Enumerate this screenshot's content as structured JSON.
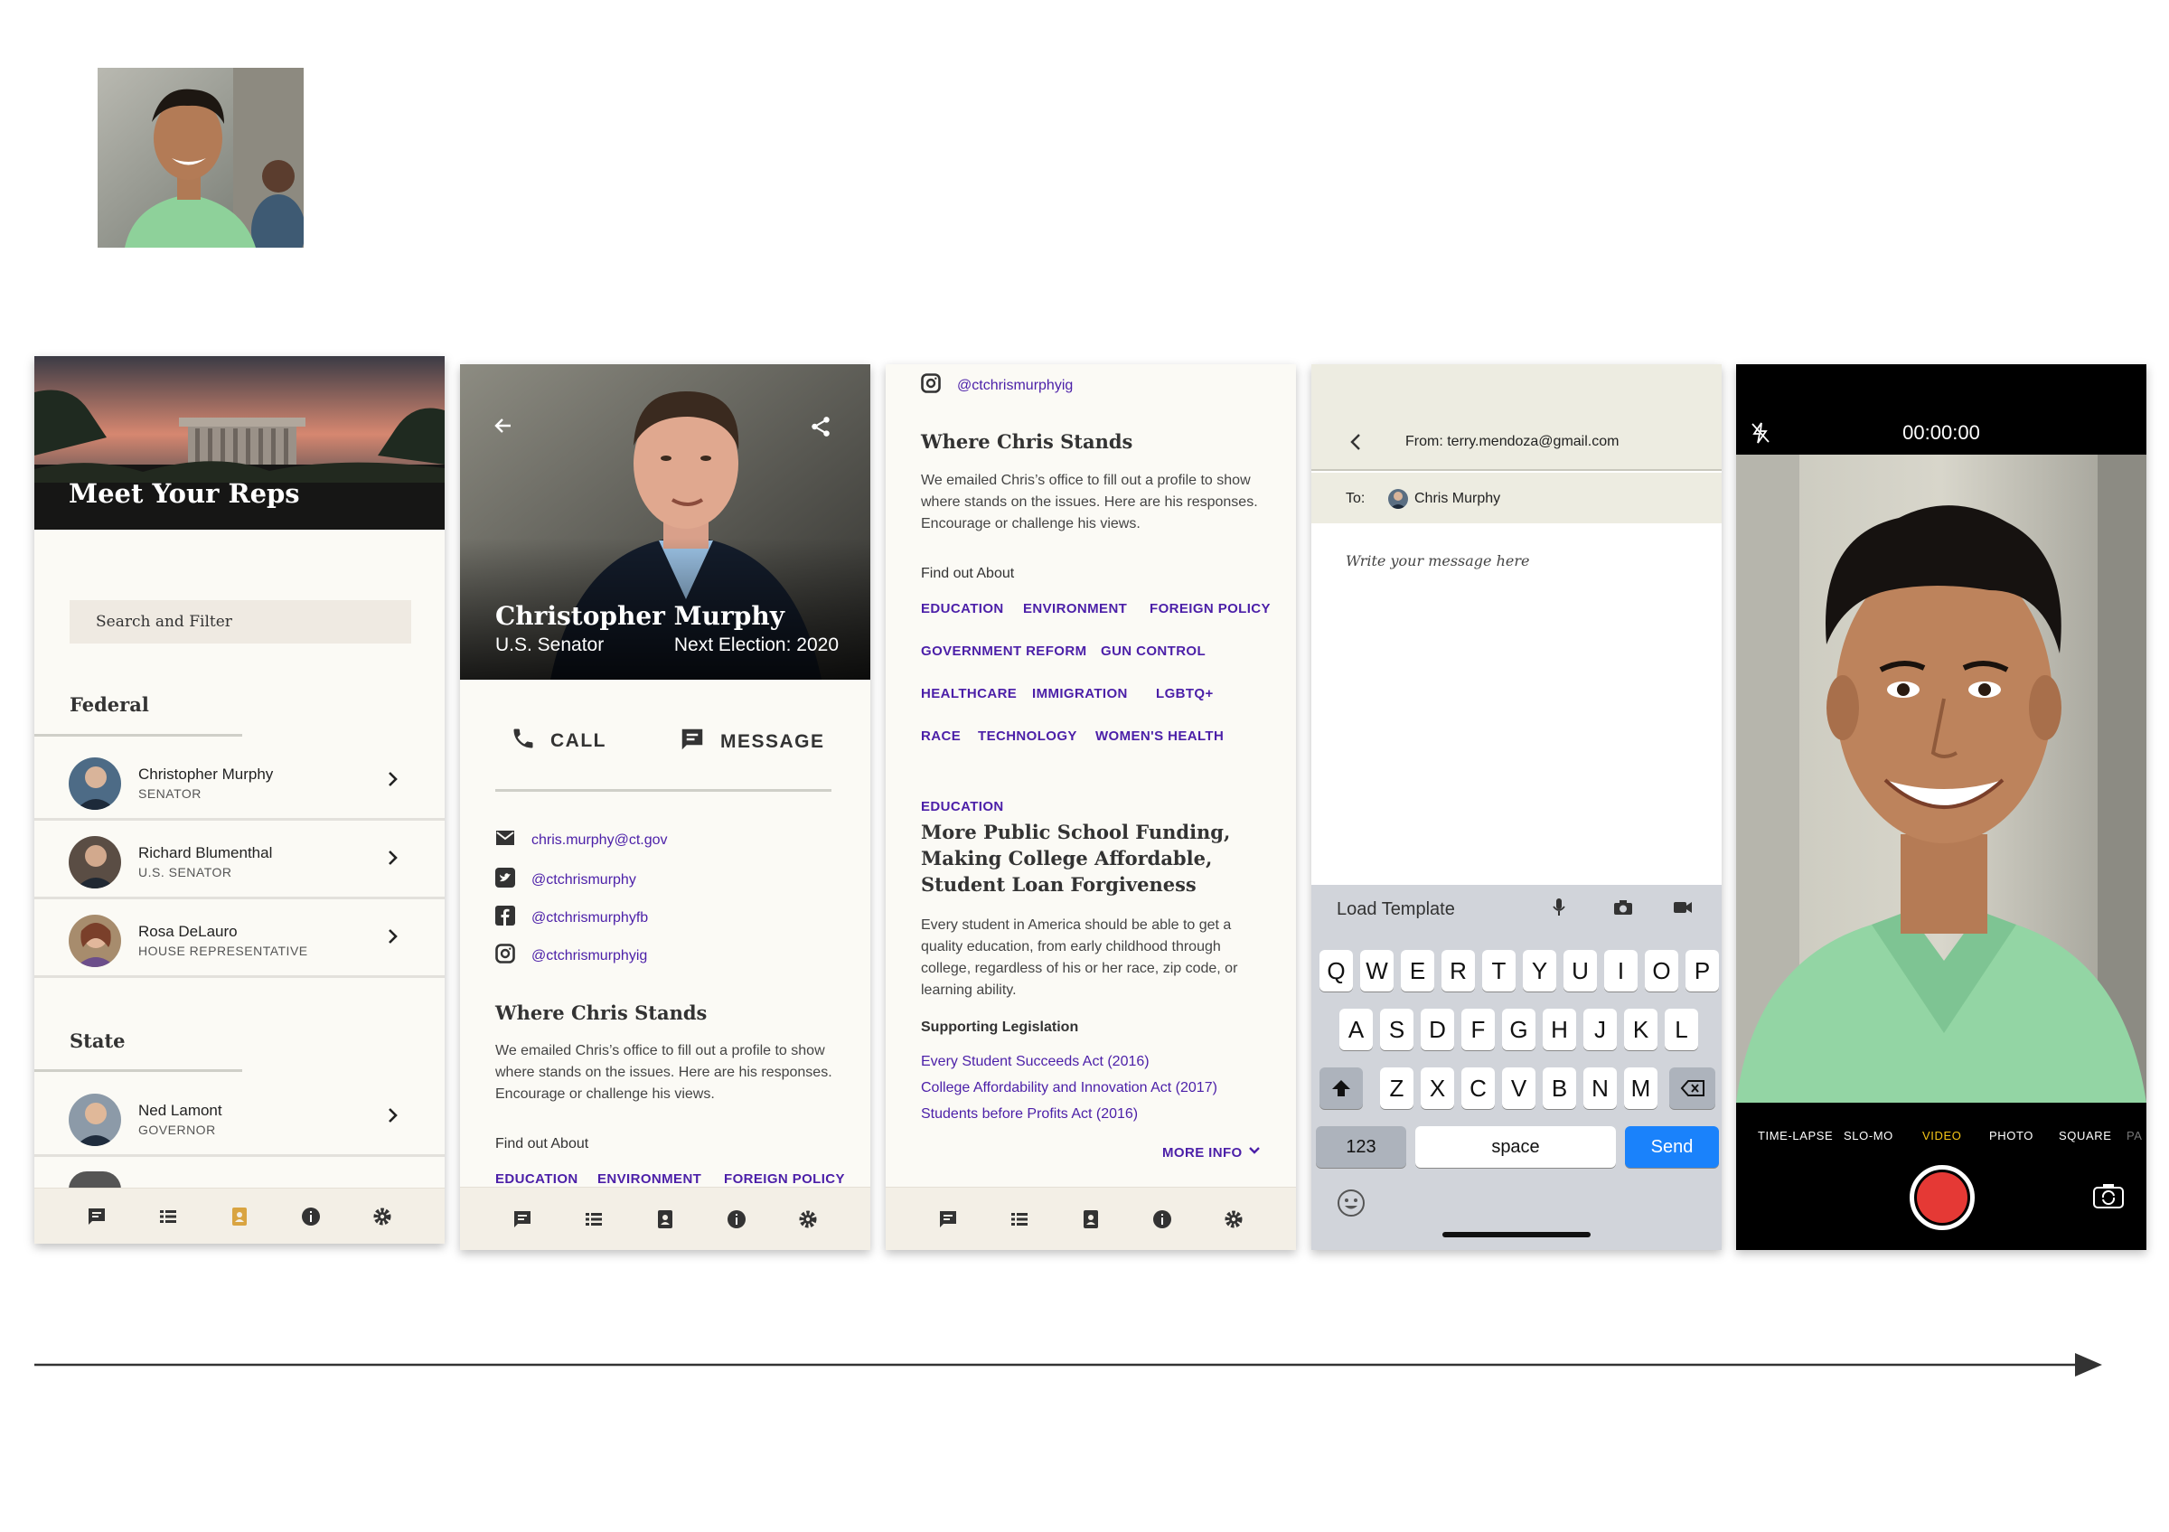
{
  "screen1": {
    "title": "Meet Your Reps",
    "search_label": "Search and Filter",
    "section_federal": "Federal",
    "section_state": "State",
    "federal_reps": [
      {
        "name": "Christopher Murphy",
        "role": "SENATOR"
      },
      {
        "name": "Richard Blumenthal",
        "role": "U.S. SENATOR"
      },
      {
        "name": "Rosa DeLauro",
        "role": "HOUSE REPRESENTATIVE"
      }
    ],
    "state_reps": [
      {
        "name": "Ned Lamont",
        "role": "GOVERNOR"
      }
    ],
    "accent": "#d9a441"
  },
  "screen2": {
    "name": "Christopher Murphy",
    "title": "U.S. Senator",
    "election": "Next Election: 2020",
    "call_label": "CALL",
    "message_label": "MESSAGE",
    "contacts": {
      "email": "chris.murphy@ct.gov",
      "twitter": "@ctchrismurphy",
      "facebook": "@ctchrismurphyfb",
      "instagram": "@ctchrismurphyig"
    },
    "stands_heading": "Where Chris Stands",
    "stands_body": "We emailed Chris’s office to fill out a profile to show where stands on the issues. Here are his responses. Encourage or challenge his views.",
    "find_out": "Find out About",
    "tags": [
      "EDUCATION",
      "ENVIRONMENT",
      "FOREIGN POLICY"
    ]
  },
  "screen3": {
    "instagram": "@ctchrismurphyig",
    "stands_heading": "Where Chris Stands",
    "stands_body": "We emailed Chris’s office to fill out a profile to show where stands on the issues. Here are his responses. Encourage or challenge his views.",
    "find_out": "Find out About",
    "tags": [
      "EDUCATION",
      "ENVIRONMENT",
      "FOREIGN POLICY",
      "GOVERNMENT REFORM",
      "GUN CONTROL",
      "HEALTHCARE",
      "IMMIGRATION",
      "LGBTQ+",
      "RACE",
      "TECHNOLOGY",
      "WOMEN'S HEALTH"
    ],
    "issue_label": "EDUCATION",
    "issue_heading": "More Public School Funding, Making College Affordable, Student Loan Forgiveness",
    "issue_body": "Every student in America should be able to get a quality education, from early childhood through college, regardless of his or her race, zip code, or learning ability.",
    "supporting": "Supporting Legislation",
    "legislation": [
      "Every Student Succeeds Act (2016)",
      "College Affordability and Innovation Act (2017)",
      "Students before Profits Act (2016)"
    ],
    "more_info": "MORE INFO"
  },
  "screen4": {
    "from": "From: terry.mendoza@gmail.com",
    "to_label": "To:",
    "to_name": "Chris Murphy",
    "placeholder": "Write your message here",
    "load_template": "Load Template",
    "row1": [
      "Q",
      "W",
      "E",
      "R",
      "T",
      "Y",
      "U",
      "I",
      "O",
      "P"
    ],
    "row2": [
      "A",
      "S",
      "D",
      "F",
      "G",
      "H",
      "J",
      "K",
      "L"
    ],
    "row3": [
      "Z",
      "X",
      "C",
      "V",
      "B",
      "N",
      "M"
    ],
    "num_key": "123",
    "space_key": "space",
    "send_key": "Send",
    "send_color": "#1a82fb"
  },
  "screen5": {
    "timer": "00:00:00",
    "modes": [
      "TIME-LAPSE",
      "SLO-MO",
      "VIDEO",
      "PHOTO",
      "SQUARE",
      "PA"
    ],
    "active_mode": "VIDEO",
    "active_color": "#f5c518",
    "record_color": "#e53935"
  }
}
